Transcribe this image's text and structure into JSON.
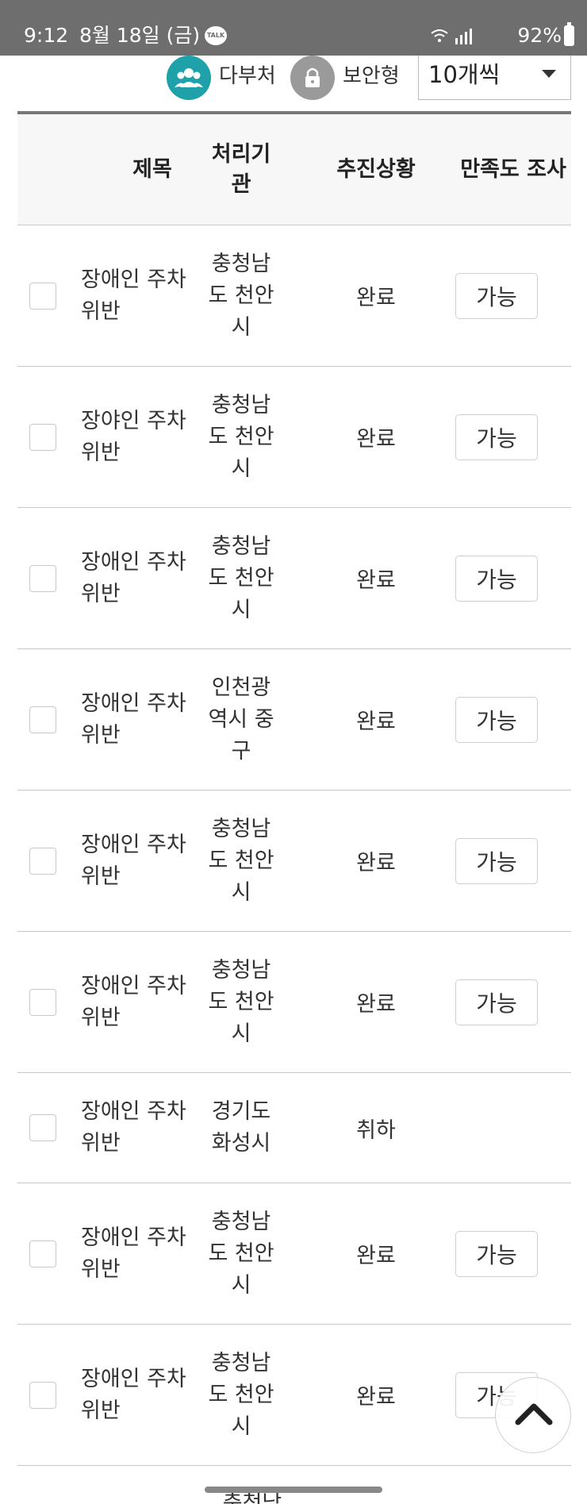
{
  "status_bar": {
    "time": "9:12",
    "date": "8월 18일 (금)",
    "talk_badge": "TALK",
    "battery": "92%"
  },
  "filters": {
    "dept_label": "다부처",
    "secure_label": "보안형",
    "per_page": "10개씩"
  },
  "table": {
    "headers": {
      "title": "제목",
      "org": "처리기관",
      "status": "추진상황",
      "survey": "만족도 조사"
    },
    "rows": [
      {
        "title": "장애인 주차위반",
        "org": "충청남도 천안시",
        "status": "완료",
        "survey": "가능"
      },
      {
        "title": "장야인 주차위반",
        "org": "충청남도 천안시",
        "status": "완료",
        "survey": "가능"
      },
      {
        "title": "장애인 주차위반",
        "org": "충청남도 천안시",
        "status": "완료",
        "survey": "가능"
      },
      {
        "title": "장애인 주차위반",
        "org": "인천광역시 중구",
        "status": "완료",
        "survey": "가능"
      },
      {
        "title": "장애인 주차위반",
        "org": "충청남도 천안시",
        "status": "완료",
        "survey": "가능"
      },
      {
        "title": "장애인 주차위반",
        "org": "충청남도 천안시",
        "status": "완료",
        "survey": "가능"
      },
      {
        "title": "장애인 주차위반",
        "org": "경기도 화성시",
        "status": "취하",
        "survey": ""
      },
      {
        "title": "장애인 주차위반",
        "org": "충청남도 천안시",
        "status": "완료",
        "survey": "가능"
      },
      {
        "title": "장애인 주차위반",
        "org": "충청남도 천안시",
        "status": "완료",
        "survey": "가능"
      }
    ],
    "partial_next_org": "충청남"
  },
  "colors": {
    "status_bar": "#6e6e6e",
    "dept_icon": "#1ea1a8",
    "secure_icon": "#9a9a9a"
  }
}
